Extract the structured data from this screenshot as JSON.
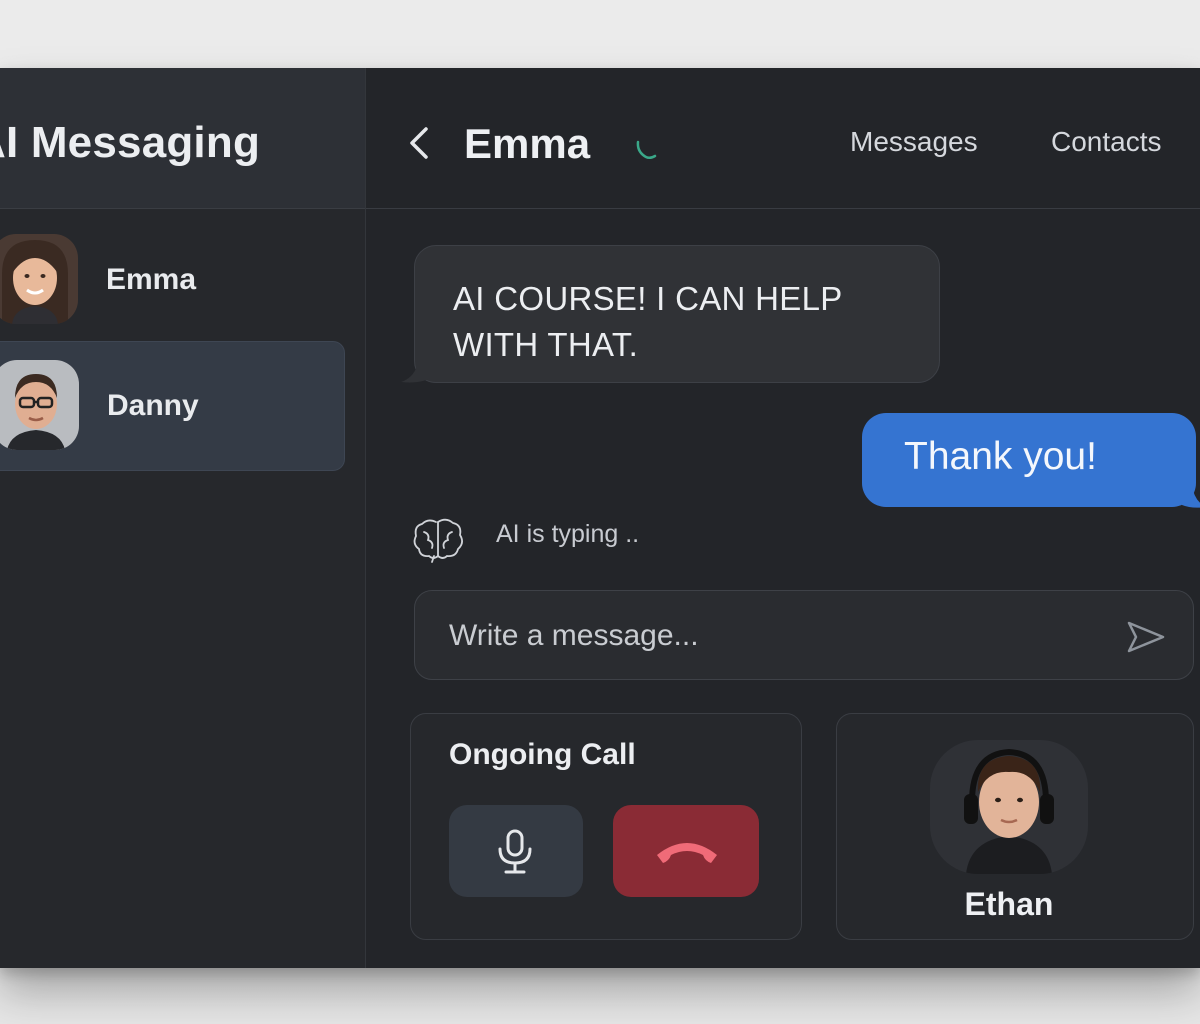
{
  "app": {
    "title": "AI Messaging"
  },
  "sidebar": {
    "contacts": [
      {
        "name": "Emma",
        "selected": false
      },
      {
        "name": "Danny",
        "selected": true
      }
    ]
  },
  "header": {
    "title": "Emma",
    "nav": {
      "messages_label": "Messages",
      "contacts_label": "Contacts"
    }
  },
  "conversation": {
    "incoming_text": "AI COURSE! I CAN HELP WITH THAT.",
    "outgoing_text": "Thank you!",
    "typing_status": "AI is typing .."
  },
  "composer": {
    "placeholder": "Write a message...",
    "value": ""
  },
  "call": {
    "title": "Ongoing Call",
    "participant_name": "Ethan"
  },
  "colors": {
    "accent_blue": "#3574d1",
    "hangup_red": "#8a2b35",
    "call_status_green": "#3aa889"
  },
  "icons": [
    "back-chevron",
    "phone-icon",
    "brain-icon",
    "send-icon",
    "microphone-icon",
    "hangup-phone-icon"
  ]
}
